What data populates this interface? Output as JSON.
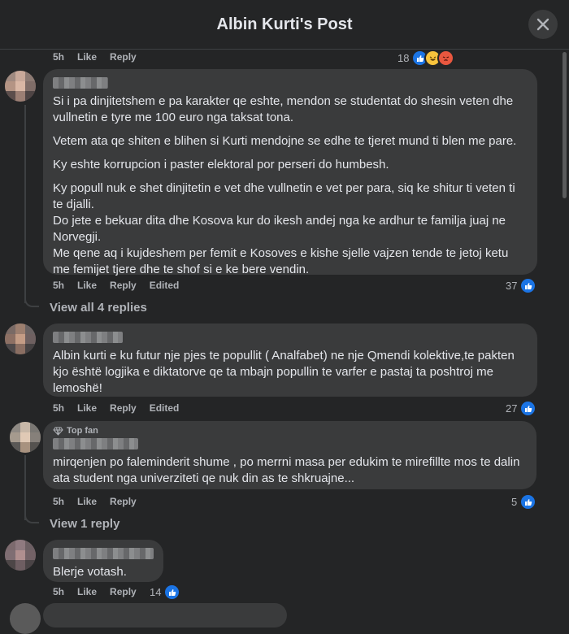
{
  "header": {
    "title": "Albin Kurti's Post"
  },
  "colors": {
    "background": "#242526",
    "bubble": "#3a3b3c",
    "like": "#1b74e4",
    "text": "#e4e6eb",
    "muted": "#b0b3b8"
  },
  "top_meta": {
    "time": "5h",
    "like": "Like",
    "reply": "Reply",
    "reactions": "18"
  },
  "comments": [
    {
      "paragraphs": [
        "Si i pa dinjitetshem e pa karakter qe eshte, mendon se studentat do shesin veten dhe vullnetin e tyre me 100 euro nga taksat tona.",
        "Vetem ata qe shiten e blihen si Kurti mendojne se edhe te tjeret mund ti blen me pare.",
        "Ky eshte korrupcion i paster elektoral por perseri do humbesh.",
        "Ky popull nuk e shet dinjitetin e vet dhe vullnetin e vet per para, siq ke shitur ti veten ti te djalli.",
        "Do jete e bekuar dita dhe Kosova kur do ikesh andej nga ke ardhur te familja juaj ne Norvegji.",
        "Me qene aq i kujdeshem per femit e Kosoves e kishe sjelle vajzen tende te jetoj ketu me femijet tjere dhe te shof si e ke bere vendin."
      ],
      "time": "5h",
      "like": "Like",
      "reply": "Reply",
      "edited": "Edited",
      "reactions": "37",
      "replies": "View all 4 replies"
    },
    {
      "paragraphs": [
        "Albin kurti e ku futur nje pjes te popullit ( Analfabet) ne nje Qmendi kolektive,te pakten kjo është logjika e diktatorve qe ta mbajn popullin te varfer e pastaj ta poshtroj me lemoshë!"
      ],
      "time": "5h",
      "like": "Like",
      "reply": "Reply",
      "edited": "Edited",
      "reactions": "27"
    },
    {
      "badge": "Top fan",
      "paragraphs": [
        "mirqenjen po faleminderit shume , po merrni masa per edukim te mirefillte mos te dalin ata student nga univerziteti qe nuk din as te shkruajne..."
      ],
      "time": "5h",
      "like": "Like",
      "reply": "Reply",
      "reactions": "5",
      "replies": "View 1 reply"
    },
    {
      "paragraphs": [
        "Blerje votash."
      ],
      "time": "5h",
      "like": "Like",
      "reply": "Reply",
      "reactions": "14"
    }
  ]
}
